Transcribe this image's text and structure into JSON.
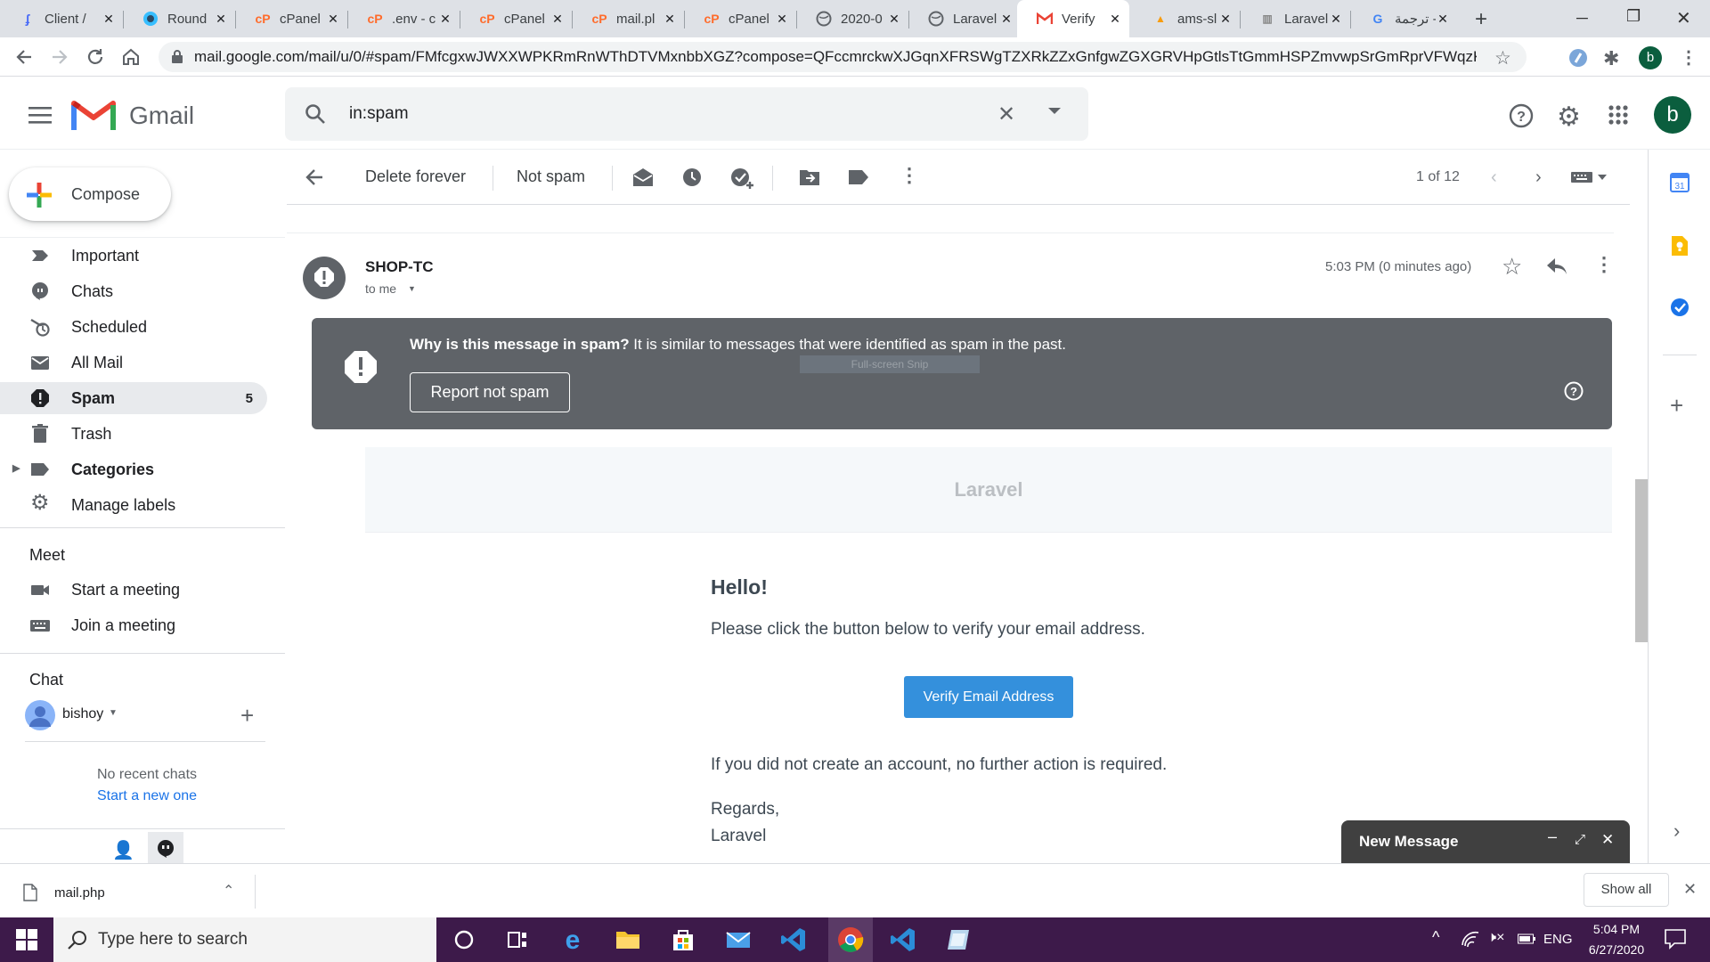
{
  "browser": {
    "tabs": [
      {
        "title": "Client /",
        "favicon": "feather-icon"
      },
      {
        "title": "Round",
        "favicon": "roundcube-icon"
      },
      {
        "title": "cPanel",
        "favicon": "cpanel-icon"
      },
      {
        "title": ".env - c",
        "favicon": "cpanel-icon"
      },
      {
        "title": "cPanel",
        "favicon": "cpanel-icon"
      },
      {
        "title": "mail.pl",
        "favicon": "cpanel-icon"
      },
      {
        "title": "cPanel",
        "favicon": "cpanel-icon"
      },
      {
        "title": "2020-0",
        "favicon": "globe-icon"
      },
      {
        "title": "Laravel",
        "favicon": "globe-icon"
      },
      {
        "title": "Verify",
        "favicon": "gmail-icon"
      },
      {
        "title": "ams-sl",
        "favicon": "phpmyadmin-icon"
      },
      {
        "title": "Laravel",
        "favicon": "laravel-icon"
      },
      {
        "title": "ترجمة -",
        "favicon": "google-icon"
      }
    ],
    "new_tab": "+",
    "url": "mail.google.com/mail/u/0/#spam/FMfcgxwJWXXWPKRmRnWThDTVMxnbbXGZ?compose=QFccmrckwXJGqnXFRSWgTZXRkZZxGnfgwZGXGRVHpGtlsTtGmmHSPZmvwpSrGmRprVFWqzKKFrp...",
    "profile_initial": "b"
  },
  "gmail": {
    "logo_text": "Gmail",
    "search_value": "in:spam",
    "account_initial": "b",
    "compose_label": "Compose",
    "nav": [
      {
        "label": "Important",
        "icon": "important-icon"
      },
      {
        "label": "Chats",
        "icon": "chat-icon"
      },
      {
        "label": "Scheduled",
        "icon": "scheduled-icon"
      },
      {
        "label": "All Mail",
        "icon": "mail-icon"
      },
      {
        "label": "Spam",
        "icon": "spam-icon",
        "count": "5"
      },
      {
        "label": "Trash",
        "icon": "trash-icon"
      },
      {
        "label": "Categories",
        "icon": "label-icon"
      },
      {
        "label": "Manage labels",
        "icon": "gear-icon"
      }
    ],
    "meet": {
      "heading": "Meet",
      "items": [
        "Start a meeting",
        "Join a meeting"
      ]
    },
    "chat": {
      "heading": "Chat",
      "user": "bishoy",
      "empty_text": "No recent chats",
      "start_link": "Start a new one"
    },
    "actions": {
      "delete_forever": "Delete forever",
      "not_spam": "Not spam",
      "pagination": "1 of 12"
    },
    "message": {
      "sender": "SHOP-TC",
      "to": "to me",
      "time": "5:03 PM (0 minutes ago)",
      "spam_notice_bold": "Why is this message in spam?",
      "spam_notice_rest": " It is similar to messages that were identified as spam in the past.",
      "report_not_spam": "Report not spam",
      "overlay_text": "Full-screen Snip",
      "email_header": "Laravel",
      "greeting": "Hello!",
      "line1": "Please click the button below to verify your email address.",
      "button": "Verify Email Address",
      "line2": "If you did not create an account, no further action is required.",
      "regards": "Regards,",
      "signature": "Laravel"
    },
    "new_message_title": "New Message"
  },
  "downloads": {
    "file": "mail.php",
    "show_all": "Show all"
  },
  "taskbar": {
    "search_placeholder": "Type here to search",
    "lang": "ENG",
    "time": "5:04 PM",
    "date": "6/27/2020"
  },
  "colors": {
    "gmail_red": "#ea4335",
    "warn_bg": "#5f6368",
    "verify_button": "#3490dc",
    "taskbar": "#3d1a4a",
    "spam_selected": "#e8eaed"
  }
}
